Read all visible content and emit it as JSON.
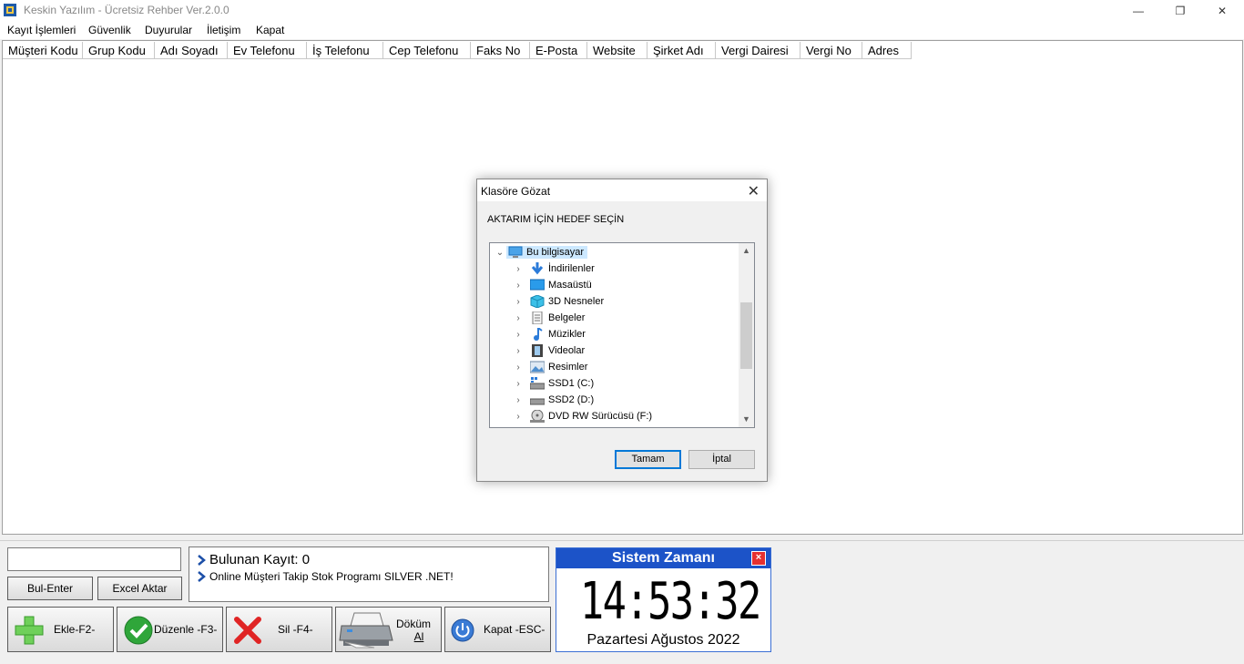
{
  "window": {
    "title": "Keskin Yazılım - Ücretsiz Rehber Ver.2.0.0",
    "minimize": "—",
    "restore": "❐",
    "close": "✕"
  },
  "menu": [
    "Kayıt İşlemleri",
    "Güvenlik",
    "Duyurular",
    "İletişim",
    "Kapat"
  ],
  "grid": {
    "columns": [
      "Müşteri Kodu",
      "Grup Kodu",
      "Adı Soyadı",
      "Ev Telefonu",
      "İş Telefonu",
      "Cep Telefonu",
      "Faks No",
      "E-Posta",
      "Website",
      "Şirket Adı",
      "Vergi Dairesi",
      "Vergi No",
      "Adres"
    ]
  },
  "search": {
    "value": "",
    "find_label": "Bul-Enter",
    "excel_label": "Excel Aktar"
  },
  "info": {
    "found_label": "Bulunan Kayıt: 0",
    "ad_text": "Online Müşteri Takip Stok Programı SILVER .NET!"
  },
  "actions": {
    "add": "Ekle-F2-",
    "edit": "Düzenle -F3-",
    "delete": "Sil -F4-",
    "print_line1": "Döküm",
    "print_line2": "Al",
    "exit": "Kapat -ESC-"
  },
  "clock": {
    "title": "Sistem Zamanı",
    "time": "14:53:32",
    "date": "Pazartesi Ağustos 2022"
  },
  "dialog": {
    "title": "Klasöre Gözat",
    "instruction": "AKTARIM İÇİN HEDEF SEÇİN",
    "root": "Bu bilgisayar",
    "items": [
      "İndirilenler",
      "Masaüstü",
      "3D Nesneler",
      "Belgeler",
      "Müzikler",
      "Videolar",
      "Resimler",
      "SSD1 (C:)",
      "SSD2 (D:)",
      "DVD RW Sürücüsü (F:)"
    ],
    "ok": "Tamam",
    "cancel": "İptal"
  },
  "colors": {
    "clock_header": "#1c53c8",
    "selection": "#cce8ff",
    "default_button_border": "#0078d7"
  }
}
